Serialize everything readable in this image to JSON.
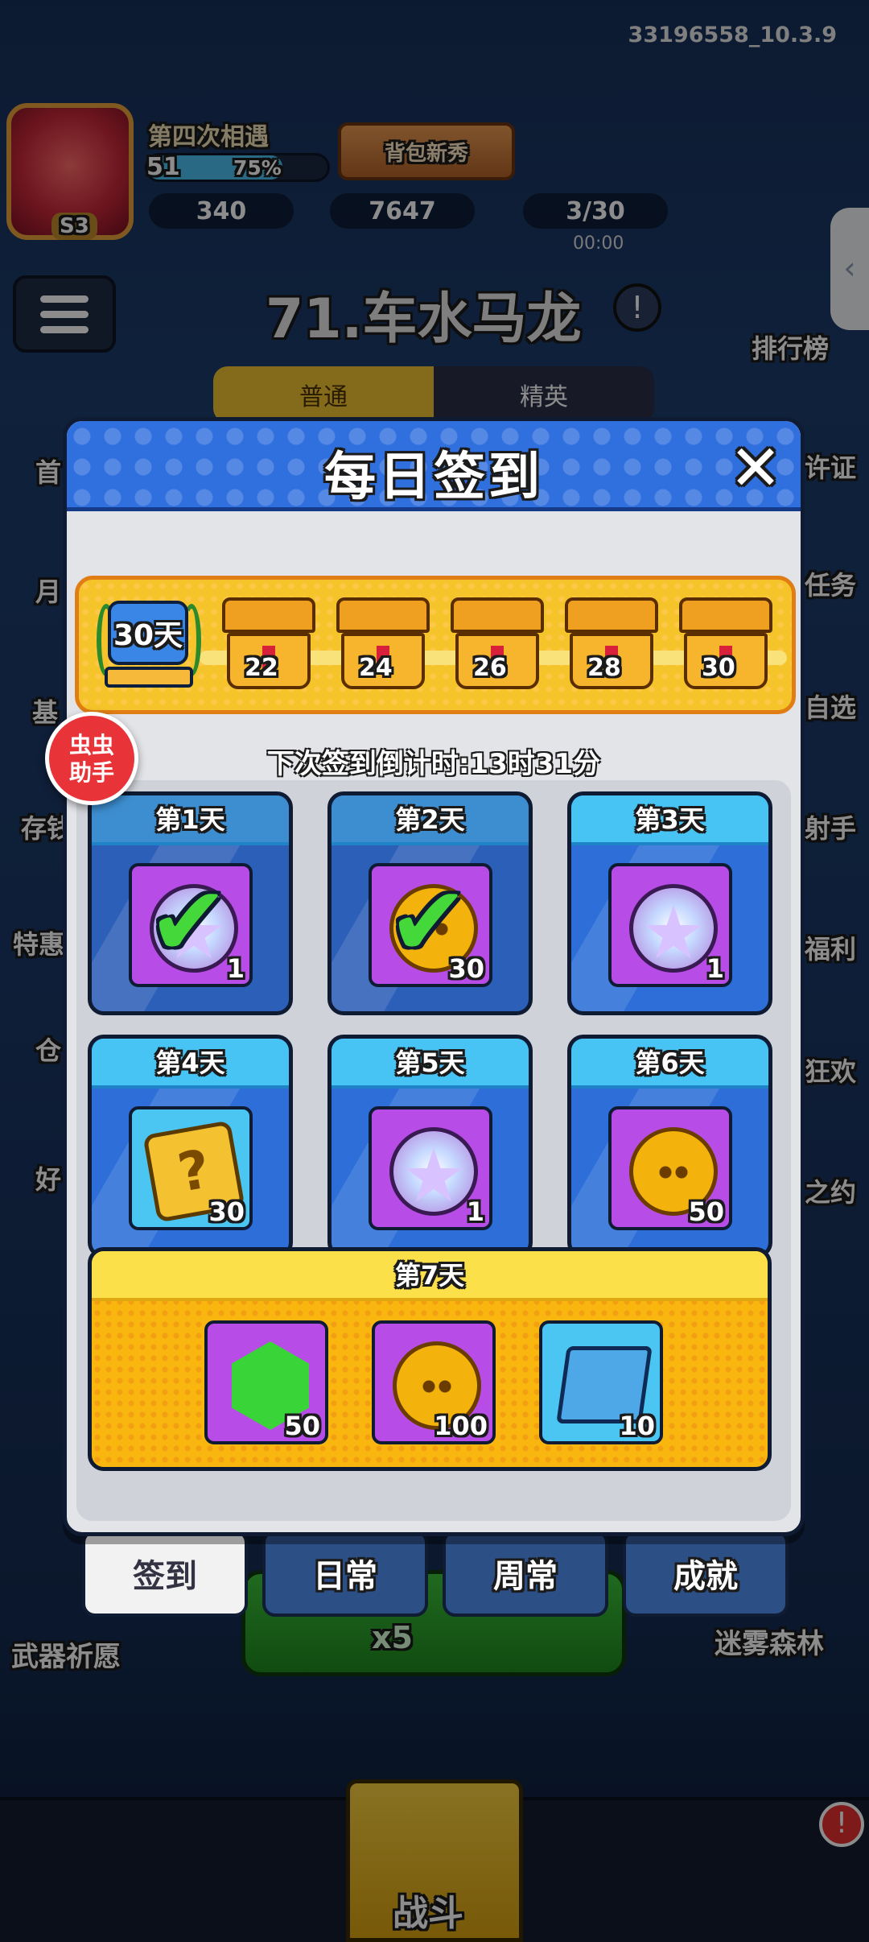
{
  "top_bar": {
    "version": "33196558_10.3.9",
    "player_name": "第四次相遇",
    "level": "51",
    "xp_percent": "75%",
    "xp_fraction": 0.75,
    "gems": "340",
    "coins": "7647",
    "energy": "3/30",
    "energy_timer": "00:00",
    "bag_button": "背包新秀"
  },
  "stage": {
    "title": "71.车水马龙",
    "mode_normal": "普通",
    "mode_elite": "精英"
  },
  "side_left": [
    "首",
    "月",
    "基",
    "存钱",
    "特惠",
    "仓",
    "好"
  ],
  "side_right": [
    "排行榜",
    "许证",
    "任务",
    "自选",
    "射手",
    "福利",
    "狂欢",
    "之约"
  ],
  "dialog": {
    "title": "每日签到",
    "close_icon": "close-icon",
    "badge_text": "30天",
    "milestones": [
      "22",
      "24",
      "26",
      "28",
      "30"
    ],
    "countdown": "下次签到倒计时:13时31分",
    "days": [
      {
        "label": "第1天",
        "qty": "1",
        "item": "star-orb-icon",
        "claimed": true
      },
      {
        "label": "第2天",
        "qty": "30",
        "item": "coin-icon",
        "claimed": true
      },
      {
        "label": "第3天",
        "qty": "1",
        "item": "star-orb-icon",
        "claimed": false
      },
      {
        "label": "第4天",
        "qty": "30",
        "item": "mystery-box-icon",
        "claimed": false
      },
      {
        "label": "第5天",
        "qty": "1",
        "item": "star-orb-icon",
        "claimed": false
      },
      {
        "label": "第6天",
        "qty": "50",
        "item": "coin-icon",
        "claimed": false
      }
    ],
    "day7": {
      "label": "第7天",
      "rewards": [
        {
          "qty": "50",
          "item": "gem-icon"
        },
        {
          "qty": "100",
          "item": "coin-icon"
        },
        {
          "qty": "10",
          "item": "book-icon"
        }
      ]
    }
  },
  "helper_badge": {
    "line1": "虫虫",
    "line2": "助手"
  },
  "bottom_tabs": [
    "签到",
    "日常",
    "周常",
    "成就"
  ],
  "lower": {
    "weapons_label": "武器祈愿",
    "forest_label": "迷雾森林",
    "energy_cost": "x5",
    "battle_label": "战斗",
    "alert": "!"
  },
  "colors": {
    "dialog_header": "#2f6fde",
    "day_card": "#2d6ed8",
    "day7_gold": "#f8b60e",
    "claimed_check": "#44d83a"
  }
}
